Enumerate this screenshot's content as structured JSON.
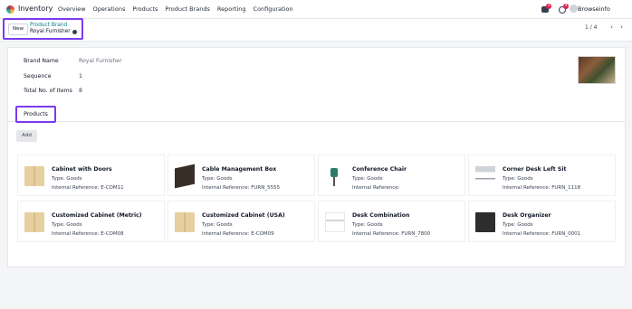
{
  "navbar": {
    "app_name": "Inventory",
    "menu": [
      "Overview",
      "Operations",
      "Products",
      "Product Brands",
      "Reporting",
      "Configuration"
    ],
    "messages_badge": "1",
    "activity_badge": "4",
    "user_name": "Browseinfo"
  },
  "control": {
    "new_label": "New",
    "breadcrumb_parent": "Product Brand",
    "breadcrumb_current": "Royal Furnisher",
    "pager": "1 / 4",
    "prev_icon": "‹",
    "next_icon": "›"
  },
  "form": {
    "brand_name_label": "Brand Name",
    "brand_name_value": "Royal Furnisher",
    "sequence_label": "Sequence",
    "sequence_value": "1",
    "total_label": "Total No. of Items",
    "total_value": "8"
  },
  "tabs": {
    "products": "Products"
  },
  "add_label": "Add",
  "products": [
    {
      "name": "Cabinet with Doors",
      "type": "Type: Goods",
      "ref": "Internal Reference: E-COM11",
      "icon": "cabinet"
    },
    {
      "name": "Cable Management Box",
      "type": "Type: Goods",
      "ref": "Internal Reference: FURN_5555",
      "icon": "box"
    },
    {
      "name": "Conference Chair",
      "type": "Type: Goods",
      "ref": "Internal Reference:",
      "icon": "chair"
    },
    {
      "name": "Corner Desk Left Sit",
      "type": "Type: Goods",
      "ref": "Internal Reference: FURN_1118",
      "icon": "desk"
    },
    {
      "name": "Customized Cabinet (Metric)",
      "type": "Type: Goods",
      "ref": "Internal Reference: E-COM08",
      "icon": "cabinet"
    },
    {
      "name": "Customized Cabinet (USA)",
      "type": "Type: Goods",
      "ref": "Internal Reference: E-COM09",
      "icon": "cabinet"
    },
    {
      "name": "Desk Combination",
      "type": "Type: Goods",
      "ref": "Internal Reference: FURN_7800",
      "icon": "desk-combo"
    },
    {
      "name": "Desk Organizer",
      "type": "Type: Goods",
      "ref": "Internal Reference: FURN_0001",
      "icon": "organizer"
    }
  ],
  "colors": {
    "accent": "#017e84",
    "highlight": "#7c3aed",
    "badge": "#e11d48"
  }
}
